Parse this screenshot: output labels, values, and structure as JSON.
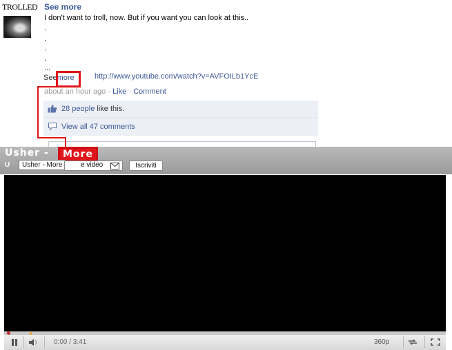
{
  "post": {
    "avatar_label": "TROLLED",
    "poster": "See more",
    "text": "I don't want to troll, now. But if you want you can look at this..",
    "dots": [
      ".",
      ".",
      ".",
      ".",
      "..."
    ],
    "see_prefix": "See",
    "see_more_link": "more",
    "url": "http://www.youtube.com/watch?v=AVFOILb1YcE",
    "meta": {
      "time": "about an hour ago",
      "separator": "·",
      "like": "Like",
      "comment": "Comment"
    },
    "likes": {
      "count_link": "28 people",
      "suffix": " like this."
    },
    "comments_link": "View all 47 comments"
  },
  "player": {
    "title": "Usher -",
    "title_more": "More",
    "subtitle": "U",
    "tooltip": "Usher - More",
    "share_video_label": "e video",
    "subscribe_label": "Iscriviti",
    "time": "0:00 / 3:41",
    "quality": "360p"
  },
  "colors": {
    "facebook_link": "#3b5998",
    "annotation_red": "#e0151b",
    "like_box_bg": "#eceff5"
  },
  "icons": [
    "thumbs-up-icon",
    "comment-bubble-icon",
    "envelope-icon",
    "pause-icon",
    "volume-icon",
    "popout-icon",
    "fullscreen-icon"
  ]
}
